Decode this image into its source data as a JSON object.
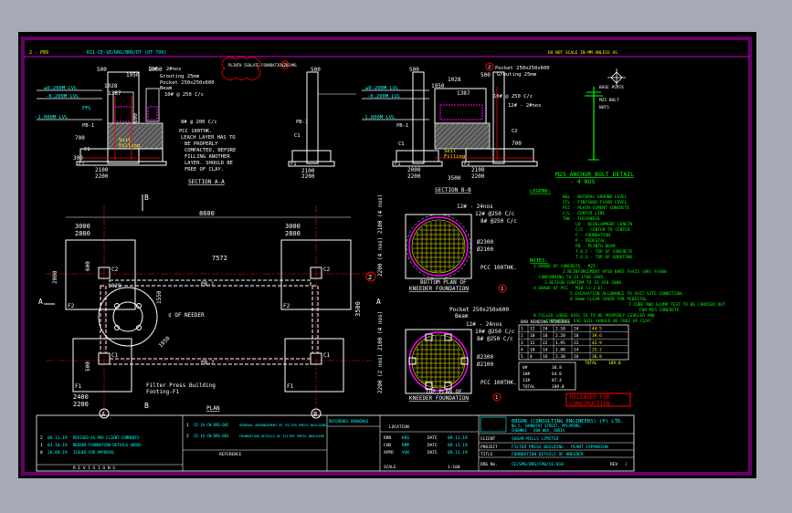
{
  "header": {
    "sheet_ref": "2 - P89",
    "file_ref": "R11-CE-SE/DRG/BRD/DT (DT 799)",
    "not_for_scale": "DO NOT SCALE IN MM UNLESS AS"
  },
  "section_aa": {
    "title": "SECTION A-A",
    "top_level": "±0.200M LVL",
    "ngl": "-0.200M LVL",
    "bottom_level": "-1.000M LVL",
    "dim_500": "500",
    "dim_1028": "1028",
    "dim_1387": "1387",
    "dim_1950": "1950",
    "dim_2100": "2100",
    "dim_2000": "2000",
    "dim_2200": "2200",
    "dim_600": "600",
    "dim_700": "700",
    "dim_300": "300",
    "label_12mm": "12# - 2#nos",
    "label_grouting": "Grouting 25mm",
    "label_pocket": "Pocket 250x250x600",
    "label_beam": "Beam",
    "label_bars": "10# @ 250 C/c",
    "label_bars2": "8# @ 200 C/c",
    "label_c1": "C1",
    "label_f1": "F1",
    "label_pb1": "PB-1",
    "label_ffl": "FFL",
    "label_pcc": "PCC 100THK.",
    "label_soil": "Soil",
    "label_filling": "Filling",
    "note_leach1": "LEACH LAYER HAS TO",
    "note_leach2": "BE PROPERLY",
    "note_leach3": "COMPACTED, BEFORE",
    "note_leach4": "FILLING ANOTHER",
    "note_leach5": "LAYER. SHOULD BE",
    "note_leach6": "FREE OF CLAY.",
    "revision_cloud": "PLINTH ISOLATE FOUNDATION BEAMS",
    "marker": "2"
  },
  "section_bb": {
    "title": "SECTION B-B",
    "top_level": "±0.200M LVL",
    "ngl": "-0.200M LVL",
    "bottom_level": "-1.000M LVL",
    "dim_1950": "1950",
    "dim_1387": "1387",
    "dim_1028": "1028",
    "dim_500": "500",
    "dim_2000": "2000",
    "dim_2200": "2200",
    "dim_3500": "3500",
    "dim_700": "700",
    "label_pocket": "Pocket 250x250x600",
    "label_grouting": "Grouting 25mm",
    "label_12mm": "12# - 2#nos",
    "label_bars": "10# @ 250 C/c",
    "label_pb1": "PB-1",
    "label_c1": "C1",
    "label_c2": "C2",
    "label_f1": "F1",
    "label_f2": "F2",
    "label_soil": "Soil",
    "label_filling": "Filling",
    "marker": "2"
  },
  "anchor": {
    "title": "M25 ANCHOR BOLT DETAIL",
    "subtitle": "- 4 NOS",
    "label_plate": "BASE PLATE",
    "label_bolt": "M25 BOLT",
    "label_nuts": "NUTS"
  },
  "legend": {
    "title": "LEGEND:",
    "items": [
      "NGL  -  NATURAL GROUND LEVEL",
      "FFL  -  FINISHED FLOOR LEVEL",
      "PCC  -  PLAIN CEMENT CONCRETE",
      "C/L  -  CENTER LINE",
      "THK  -  THICKNESS",
      "LD   -  DEVELOPMENT LENGTH",
      "C/C  -  CENTER TO CENTER",
      "F    -  FOUNDATION",
      "P    -  PEDESTAL",
      "PB   -  PLINTH BEAM",
      "T.O.C - TOP OF CONCRETE",
      "T.O.G - TOP OF GROUTING"
    ]
  },
  "notes": {
    "title": "NOTES:",
    "items": [
      "1.GRADE OF CONCRETE - M25.",
      "2.REINFORCEMENT HYSD BARS Fe415 (OR) Fe500",
      "CONFORMING TO IS 1786-1985.",
      "3.DESIGN CONFIRM TO IS 456-2000.",
      "4.GRADE OF PCC - M10 (1:3:6).",
      "5.EXCAVATION ALLOWANCE TO SUIT SITE CONDITION.",
      "6.50mm CLEAR COVER FOR PEDESTAL.",
      "7.CUBE AND SLUMP TEST TO BE CARRIED OUT",
      "FOR M25 CONCRETE.",
      "8.FILLED LOOSE SOIL IS TO BE PROPERLY LEVELED AND",
      "COMPACTED. USE SOIL SHOULD BE FREE OF CLAY."
    ]
  },
  "plan": {
    "title": "PLAN",
    "dim_8600": "8600",
    "dim_3000a": "3000",
    "dim_2800a": "2800",
    "dim_3000b": "3000",
    "dim_2800b": "2800",
    "dim_7572": "7572",
    "dim_2400": "2400",
    "dim_2200": "2200",
    "dim_3500": "3500",
    "dim_1550": "1550",
    "dim_1950": "1950",
    "dim_1028": "1028",
    "dim_600": "600",
    "dim_500": "500",
    "dim_2000": "2000",
    "label_pb1": "PB-1",
    "label_pb2": "PB-2",
    "label_c1": "C1",
    "label_c2": "C2",
    "label_f1": "F1",
    "label_f2": "F2",
    "label_center": "¢ OF NEEDER",
    "label_filter1": "Filter Press Building",
    "label_filter2": "Footing-F1",
    "grid_a": "A",
    "grid_b": "B",
    "cut_a": "A",
    "cut_b": "B",
    "marker": "2"
  },
  "needer_bottom": {
    "title1": "BOTTOM PLAN OF",
    "title2": "KNEEDER FOUNDATION",
    "label_12mm": "12# - 24nos",
    "label_10mm": "12# @250 C/c",
    "label_8mm": "8# @250 C/c",
    "dim_2300": "Ø2300",
    "dim_2100": "Ø2100",
    "label_pcc": "PCC 100THK.",
    "side_dims": "2200 (4 nos) 2100 (4 nos)",
    "marker": "1"
  },
  "needer_top": {
    "title1": "TOP PLAN OF",
    "title2": "KNEEDER FOUNDATION",
    "label_pocket": "Pocket 250x250x600",
    "label_beam": "Beam",
    "label_12mm": "12# - 24nos",
    "label_10mm": "10# @250 C/c",
    "label_8mm": "8# @250 C/c",
    "dim_2300": "Ø2300",
    "dim_2100": "Ø2100",
    "label_pcc": "PCC 100THK.",
    "side_dims": "2200 (2 nos) 2100 (4 nos)",
    "marker": "1"
  },
  "bbs": {
    "title": "BAR BENDING SCHEDULE",
    "rows": [
      [
        "1",
        "12",
        "24",
        "2.10",
        "24",
        "44.5"
      ],
      [
        "2",
        "10",
        "18",
        "2.20",
        "18",
        "39.6"
      ],
      [
        "3",
        "12",
        "22",
        "1.95",
        "22",
        "42.9"
      ],
      [
        "4",
        "10",
        "14",
        "1.80",
        "14",
        "25.2"
      ],
      [
        "5",
        "8",
        "16",
        "2.30",
        "16",
        "36.8"
      ]
    ],
    "total_label": "TOTAL",
    "total": "189.0"
  },
  "steel_table": {
    "rows": [
      [
        "8#",
        "36.8"
      ],
      [
        "10#",
        "64.8"
      ],
      [
        "12#",
        "87.4"
      ],
      [
        "TOTAL",
        "189.0"
      ]
    ]
  },
  "released": {
    "line1": "RELEASED FOR",
    "line2": "CONSTRUCTION"
  },
  "title_block": {
    "revisions": [
      [
        "2",
        "09.11.19",
        "REVISED AS PER CLIENT COMMENTS"
      ],
      [
        "1",
        "03.10.19",
        "NEEDER FOUNDATION DETAILS ADDED"
      ],
      [
        "0",
        "26.09.19",
        "ISSUED FOR APPROVAL"
      ]
    ],
    "revisions_label": "R E V I S I O N S",
    "ref_rows": [
      [
        "1",
        "CE-1A-CW-DRG-002",
        "GENERAL ARRANGEMENT OF FILTER PRESS BUILDING"
      ],
      [
        "2",
        "CE-1A-CW-DRG-003",
        "FOUNDATION DETAILS OF FILTER PRESS BUILDING"
      ]
    ],
    "ref_header": "REFERENCE",
    "drawing_header": "REFERENCE DRAWINGS",
    "lines_label": "LOCATION",
    "sign_rows": [
      [
        "DRN",
        "KRS",
        "DATE",
        "09.11.19"
      ],
      [
        "CHD",
        "RMP",
        "DATE",
        "09.11.19"
      ],
      [
        "APPD",
        "VSK",
        "DATE",
        "09.11.19"
      ]
    ],
    "scale_label": "SCALE",
    "scale_value": "1:100",
    "company_name": "ERGON (CONSULTING ENGINEERS) (P) LTD.",
    "company_addr1": "No.5, SANNATHI STREET, MYLAPORE,",
    "company_addr2": "CHENNAI - 600 004, INDIA.",
    "client_label": "CLIENT",
    "client_value": "SUGAR MILLS LIMITED",
    "project_label": "PROJECT",
    "project_value": "FILTER PRESS BUILDING - PLANT EXPANSION",
    "title_label": "TITLE",
    "title_value": "FOUNDATION DETAILS OF KNEEDER",
    "drg_label": "DRG No.",
    "drg_value": "CE/SMS/DRG/FPB/CE-018",
    "rev_label": "REV",
    "rev_value": "2"
  }
}
